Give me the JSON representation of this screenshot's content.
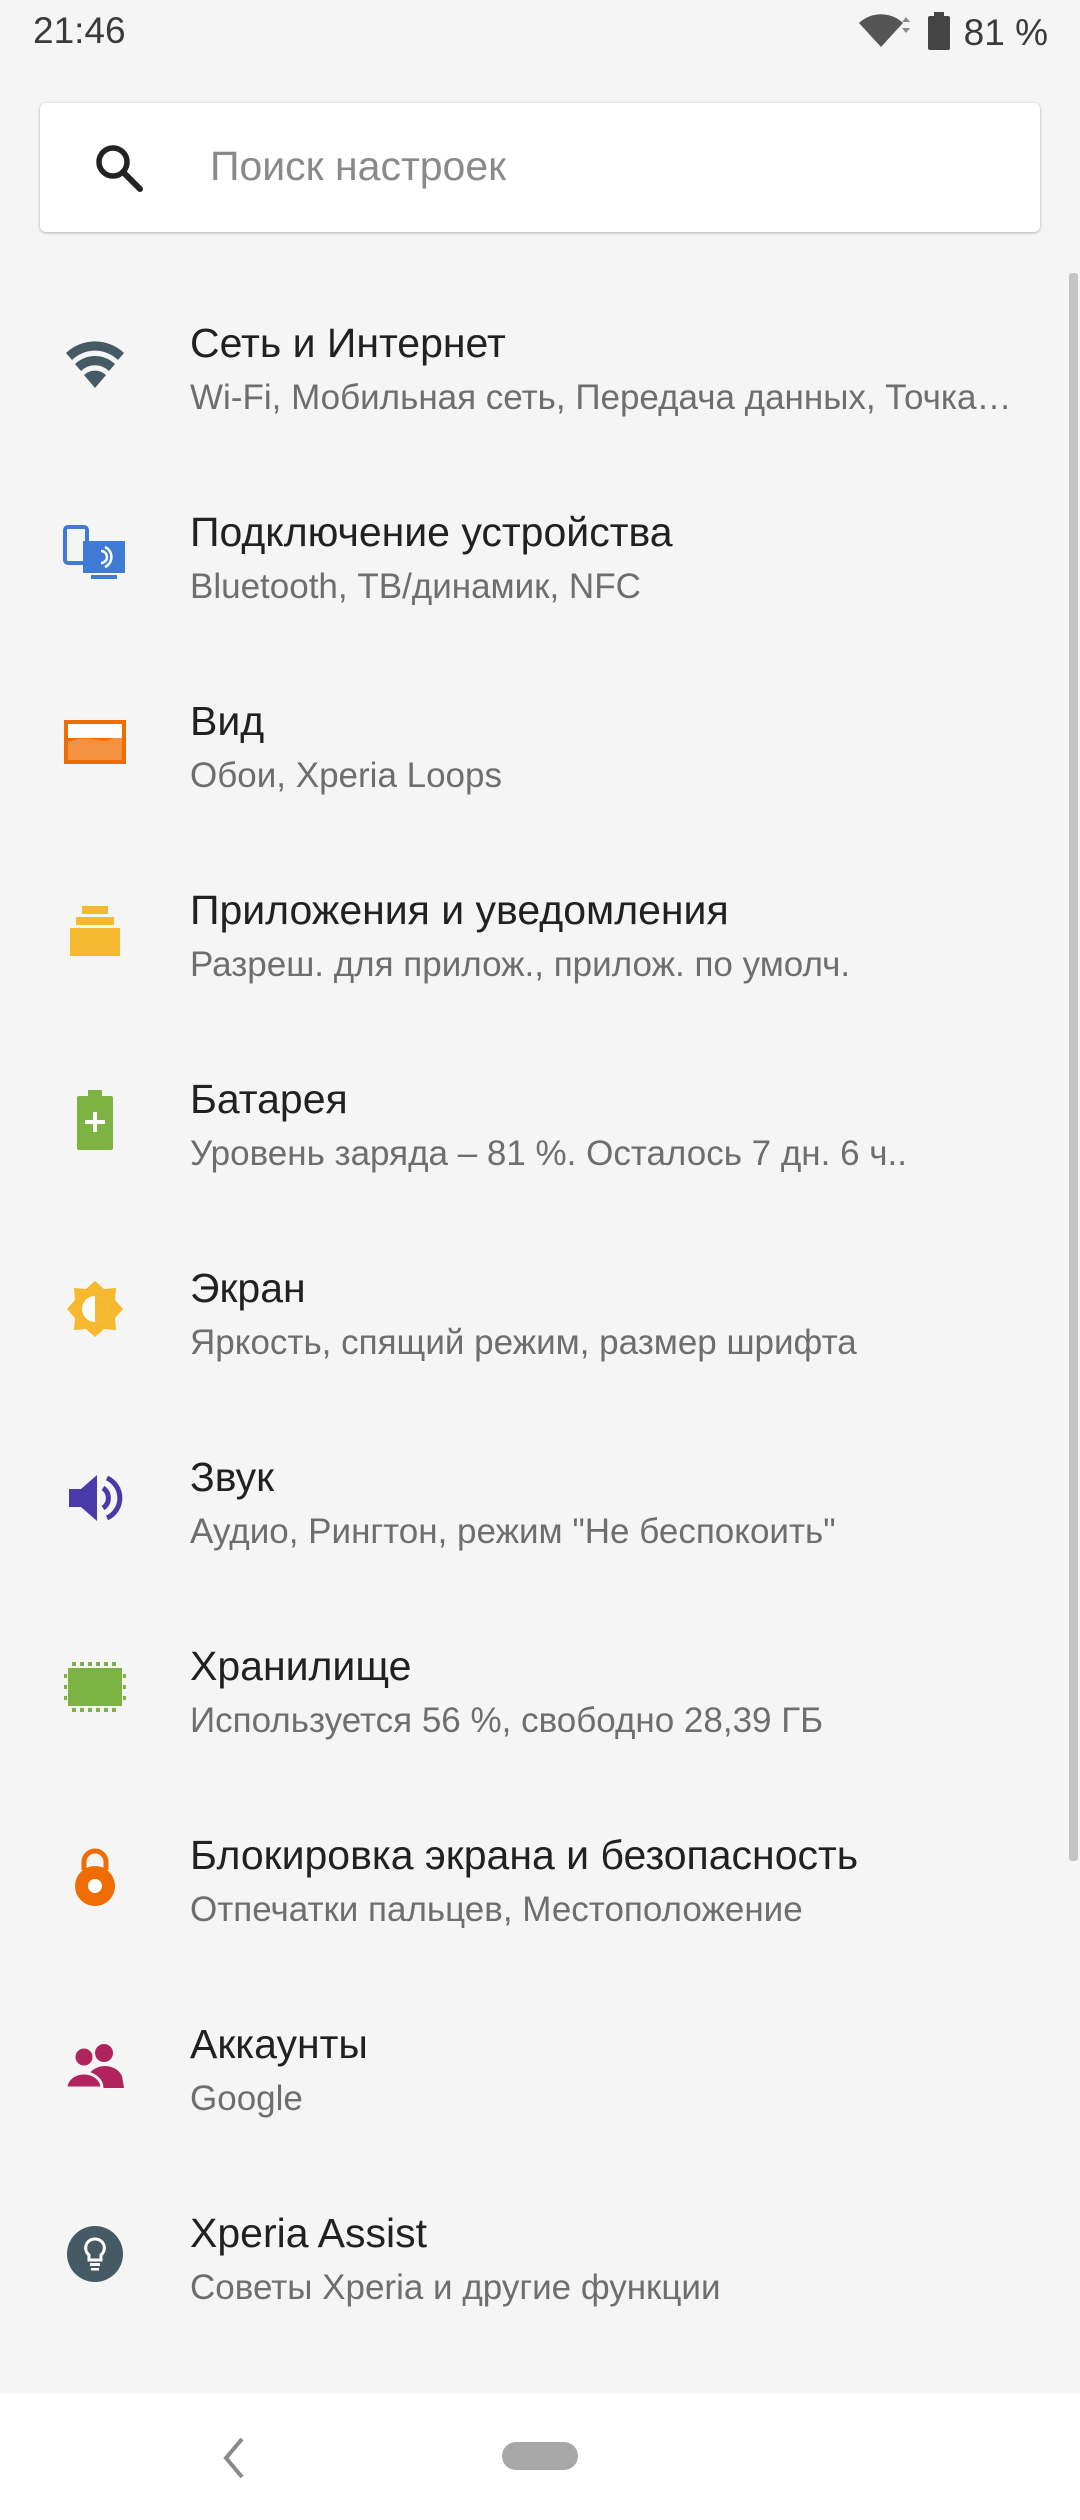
{
  "status_bar": {
    "time": "21:46",
    "battery_text": "81 %",
    "wifi_icon": "wifi-icon",
    "battery_icon": "battery-icon"
  },
  "search": {
    "placeholder": "Поиск настроек",
    "icon": "search-icon"
  },
  "settings": [
    {
      "title": "Сеть и Интернет",
      "subtitle": "Wi-Fi, Мобильная сеть, Передача данных, Точка доступа",
      "icon": "wifi-icon",
      "color": "#455a64"
    },
    {
      "title": "Подключение устройства",
      "subtitle": "Bluetooth, ТВ/динамик, NFC",
      "icon": "connected-devices-icon",
      "color": "#3f7bd4"
    },
    {
      "title": "Вид",
      "subtitle": "Обои, Xperia Loops",
      "icon": "wallpaper-icon",
      "color": "#ef6c00"
    },
    {
      "title": "Приложения и уведомления",
      "subtitle": "Разреш. для прилож., прилож. по умолч.",
      "icon": "apps-icon",
      "color": "#f4b930"
    },
    {
      "title": "Батарея",
      "subtitle": "Уровень заряда – 81 %. Осталось 7 дн. 6 ч..",
      "icon": "battery-plus-icon",
      "color": "#7cb342"
    },
    {
      "title": "Экран",
      "subtitle": "Яркость, спящий режим, размер шрифта",
      "icon": "brightness-icon",
      "color": "#f5b82e"
    },
    {
      "title": "Звук",
      "subtitle": "Аудио, Рингтон, режим \"Не беспокоить\"",
      "icon": "volume-icon",
      "color": "#4a3aa8"
    },
    {
      "title": "Хранилище",
      "subtitle": "Используется 56 %, свободно 28,39 ГБ",
      "icon": "storage-icon",
      "color": "#7cb342"
    },
    {
      "title": "Блокировка экрана и безопасность",
      "subtitle": "Отпечатки пальцев, Местоположение",
      "icon": "lock-icon",
      "color": "#ef6c00"
    },
    {
      "title": "Аккаунты",
      "subtitle": "Google",
      "icon": "accounts-icon",
      "color": "#b0245e"
    },
    {
      "title": "Xperia Assist",
      "subtitle": "Советы Xperia и другие функции",
      "icon": "lightbulb-icon",
      "color": "#455a64"
    }
  ],
  "nav_bar": {
    "back_icon": "back-icon",
    "home_icon": "home-pill-icon"
  }
}
